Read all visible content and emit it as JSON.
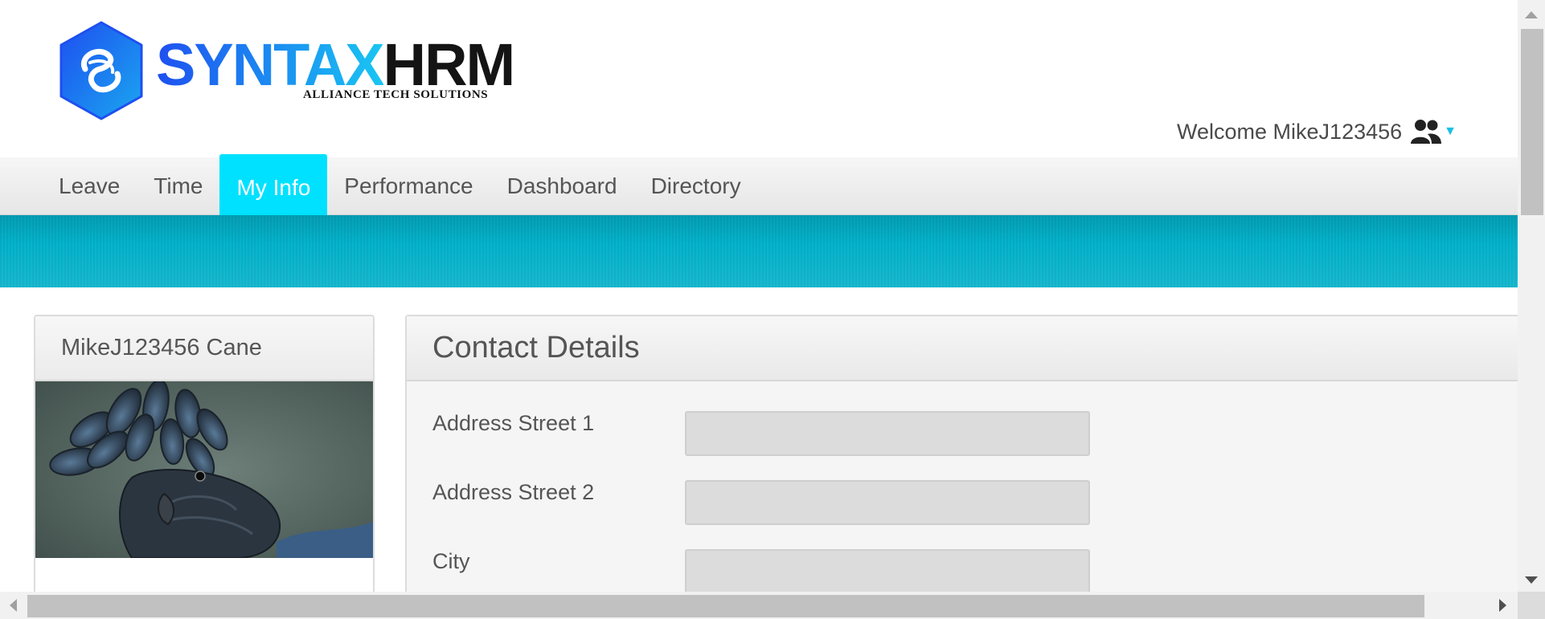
{
  "logo": {
    "brand_primary": "SYNTAX",
    "brand_secondary": "HRM",
    "tagline": "ALLIANCE TECH SOLUTIONS",
    "icon": "syntax-hexagon-logo-icon",
    "colors": {
      "primary_start": "#1e4ff0",
      "primary_end": "#19c6f2",
      "secondary": "#141414"
    }
  },
  "header": {
    "welcome_text": "Welcome MikeJ123456",
    "user_icon": "users-icon",
    "caret_icon": "caret-down-icon"
  },
  "nav": {
    "items": [
      {
        "label": "Leave",
        "active": false
      },
      {
        "label": "Time",
        "active": false
      },
      {
        "label": "My Info",
        "active": true
      },
      {
        "label": "Performance",
        "active": false
      },
      {
        "label": "Dashboard",
        "active": false
      },
      {
        "label": "Directory",
        "active": false
      }
    ],
    "active_color": "#00e1ff"
  },
  "band_color": "#06aac2",
  "profile": {
    "name": "MikeJ123456 Cane",
    "photo_subject": "black cockatoo"
  },
  "contact": {
    "title": "Contact Details",
    "fields": [
      {
        "label": "Address Street 1",
        "value": ""
      },
      {
        "label": "Address Street 2",
        "value": ""
      },
      {
        "label": "City",
        "value": ""
      }
    ]
  }
}
